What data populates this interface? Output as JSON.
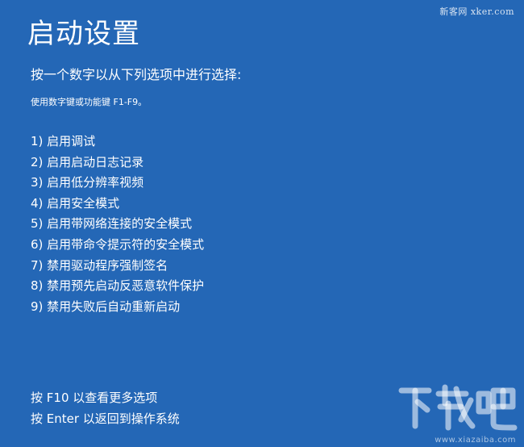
{
  "header": {
    "title": "启动设置"
  },
  "instructions": {
    "prompt": "按一个数字以从下列选项中进行选择:",
    "hint": "使用数字键或功能键 F1-F9。"
  },
  "options": [
    "1) 启用调试",
    "2) 启用启动日志记录",
    "3) 启用低分辨率视频",
    "4) 启用安全模式",
    "5) 启用带网络连接的安全模式",
    "6) 启用带命令提示符的安全模式",
    "7) 禁用驱动程序强制签名",
    "8) 禁用预先启动反恶意软件保护",
    "9) 禁用失败后自动重新启动"
  ],
  "footer": {
    "more_options": "按 F10 以查看更多选项",
    "return": "按 Enter 以返回到操作系统"
  },
  "watermarks": {
    "top": "新客网 xker.com",
    "logo_text": "下载吧",
    "bottom": "www.xiazaiba.com"
  },
  "colors": {
    "background": "#2467b6",
    "text": "#ffffff"
  }
}
